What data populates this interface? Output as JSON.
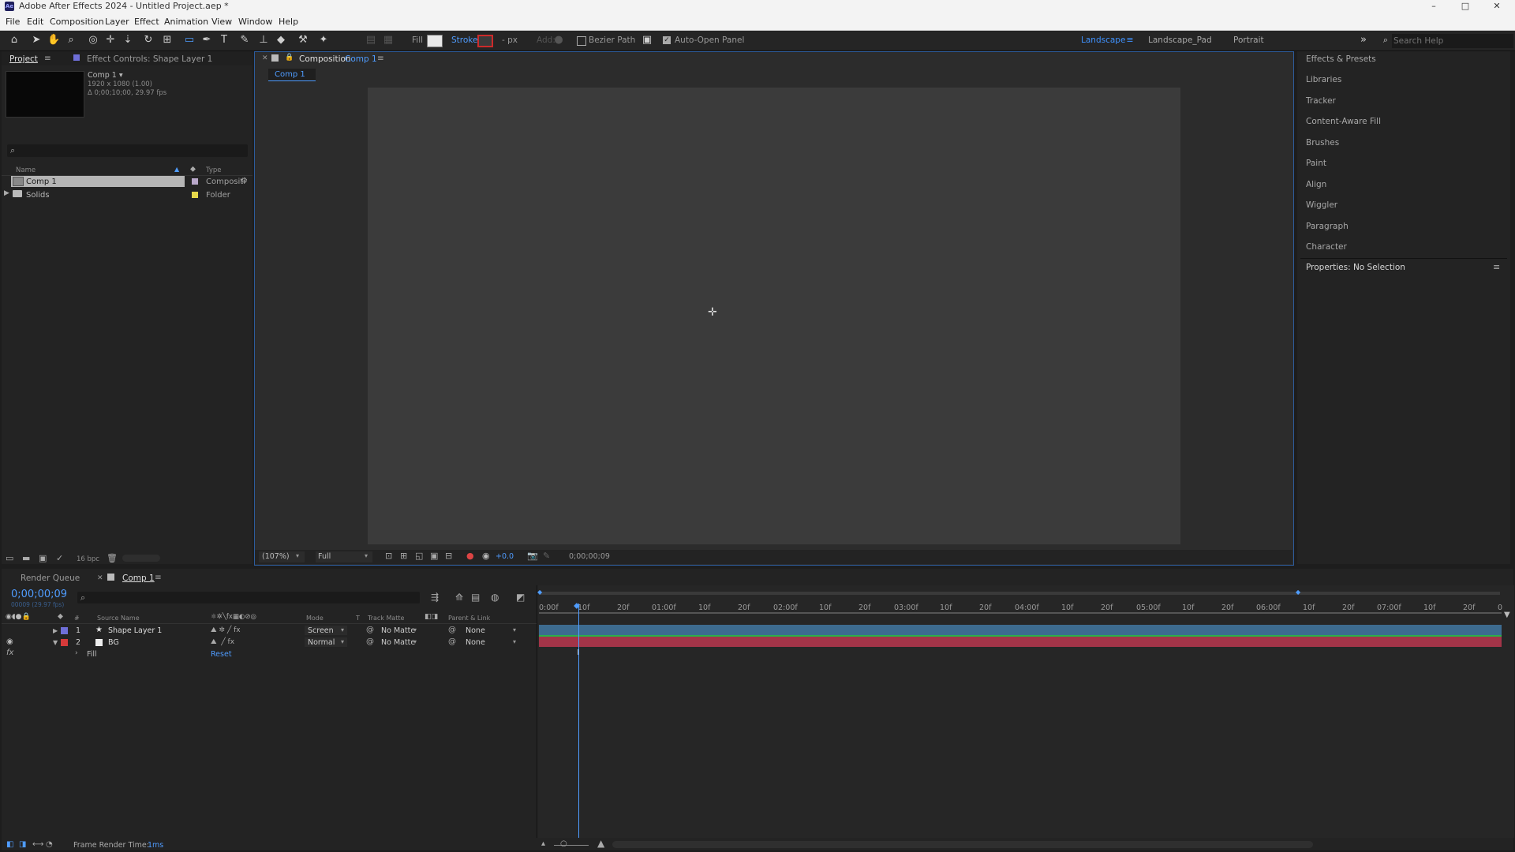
{
  "window": {
    "title": "Adobe After Effects 2024 - Untitled Project.aep *",
    "logo_text": "Ae",
    "controls": [
      "–",
      "□",
      "✕"
    ]
  },
  "menu": [
    "File",
    "Edit",
    "Composition",
    "Layer",
    "Effect",
    "Animation",
    "View",
    "Window",
    "Help"
  ],
  "toolbar": {
    "fill_label": "Fill",
    "stroke_label": "Stroke",
    "px_label": "- px",
    "add_label": "Add:",
    "bezier_label": "Bezier Path",
    "autoopen_label": "Auto-Open Panel",
    "workspaces": [
      "Landscape",
      "Landscape_Pad",
      "Portrait"
    ],
    "search_placeholder": "Search Help",
    "colors": {
      "fill": "#e8e8e8",
      "stroke": "#cc2b2b",
      "accent": "#3f92ff"
    }
  },
  "project_panel": {
    "tab_project": "Project",
    "tab_effect_controls": "Effect Controls: Shape Layer 1",
    "comp_name": "Comp 1 ▾",
    "comp_info_line1": "1920 x 1080 (1.00)",
    "comp_info_line2": "Δ 0;00;10;00, 29.97 fps",
    "columns": {
      "name": "Name",
      "type": "Type"
    },
    "items": [
      {
        "name": "Comp 1",
        "type": "Compositi",
        "label_color": "#b8a7c9"
      },
      {
        "name": "Solids",
        "type": "Folder",
        "label_color": "#e6d84a"
      }
    ],
    "bpc": "16 bpc"
  },
  "composition_panel": {
    "tab_label": "Composition",
    "tab_comp": "Comp 1",
    "breadcrumb": "Comp 1",
    "zoom": "(107%)",
    "resolution": "Full",
    "exposure": "+0.0",
    "timecode": "0;00;00;09"
  },
  "right_panel": {
    "items": [
      "Effects & Presets",
      "Libraries",
      "Tracker",
      "Content-Aware Fill",
      "Brushes",
      "Paint",
      "Align",
      "Wiggler",
      "Paragraph",
      "Character"
    ],
    "properties": "Properties: No Selection"
  },
  "timeline": {
    "tab_render_queue": "Render Queue",
    "tab_comp": "Comp 1",
    "current_time": "0;00;00;09",
    "frame_sub": "00009 (29.97 fps)",
    "columns": {
      "num": "#",
      "source": "Source Name",
      "mode": "Mode",
      "t": "T",
      "track_matte": "Track Matte",
      "parent": "Parent & Link"
    },
    "layers": [
      {
        "num": "1",
        "name": "Shape Layer 1",
        "mode": "Screen",
        "matte": "No Matte",
        "parent": "None",
        "label_color": "#6f6fd8",
        "bar_color": "#3d6b8f"
      },
      {
        "num": "2",
        "name": "BG",
        "mode": "Normal",
        "matte": "No Matte",
        "parent": "None",
        "label_color": "#d63a3a",
        "bar_color": "#a33448"
      }
    ],
    "fx_row": {
      "label": "Fill",
      "reset": "Reset"
    },
    "ruler": [
      "0:00f",
      "10f",
      "20f",
      "01:00f",
      "10f",
      "20f",
      "02:00f",
      "10f",
      "20f",
      "03:00f",
      "10f",
      "20f",
      "04:00f",
      "10f",
      "20f",
      "05:00f",
      "10f",
      "20f",
      "06:00f",
      "10f",
      "20f",
      "07:00f",
      "10f",
      "20f",
      "0"
    ],
    "frame_render_label": "Frame Render Time:",
    "frame_render_value": "1ms"
  }
}
